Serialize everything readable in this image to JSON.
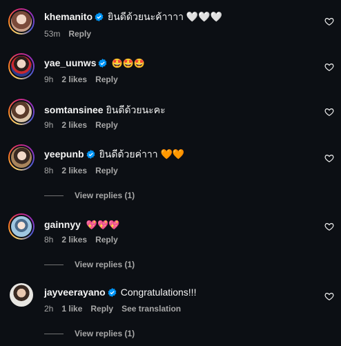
{
  "comments": [
    {
      "username": "khemanito",
      "verified": true,
      "text": "ยินดีด้วยนะค้าาาา 🤍🤍🤍",
      "time": "53m",
      "likes": "",
      "reply": "Reply",
      "avatar_ring": true,
      "avatar_color": "#c9a08a"
    },
    {
      "username": "yae_uunws",
      "verified": true,
      "text": "🤩🤩🤩",
      "time": "9h",
      "likes": "2 likes",
      "reply": "Reply",
      "avatar_ring": true,
      "avatar_color": "#2b3a8c"
    },
    {
      "username": "somtansinee",
      "verified": false,
      "text": "ยินดีด้วยนะคะ",
      "time": "9h",
      "likes": "2 likes",
      "reply": "Reply",
      "avatar_ring": true,
      "avatar_color": "#d9c3a8"
    },
    {
      "username": "yeepunb",
      "verified": true,
      "text": "ยินดีด้วยค่าาา 🧡🧡",
      "time": "8h",
      "likes": "2 likes",
      "reply": "Reply",
      "avatar_ring": true,
      "avatar_color": "#a8845c",
      "view_replies": "View replies (1)"
    },
    {
      "username": "gainnyy",
      "verified": false,
      "text": "💖💖💖",
      "time": "8h",
      "likes": "2 likes",
      "reply": "Reply",
      "avatar_ring": true,
      "avatar_color": "#9fc6e0",
      "view_replies": "View replies (1)"
    },
    {
      "username": "jayveerayano",
      "verified": true,
      "text": "Congratulations!!!",
      "time": "2h",
      "likes": "1 like",
      "reply": "Reply",
      "translation": "See translation",
      "avatar_ring": false,
      "avatar_color": "#e8e6e2",
      "view_replies": "View replies (1)"
    }
  ],
  "colors": {
    "background": "#0c0f14",
    "verified": "#0095f6",
    "meta": "#a8a8a8"
  }
}
